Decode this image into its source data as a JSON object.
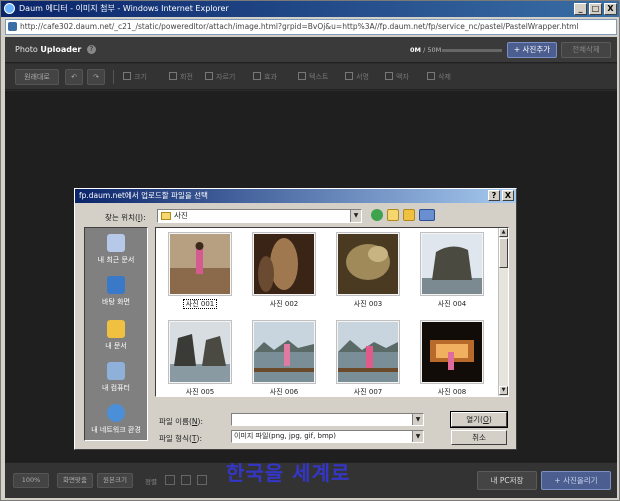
{
  "browser": {
    "title": "Daum 에디터 - 이미지 첨부 - Windows Internet Explorer",
    "address": "http://cafe302.daum.net/_c21_/static/poweredltor/attach/image.html?grpid=BvOj&u=http%3A//fp.daum.net/fp/service_nc/pastel/PastelWrapper.html",
    "controls": {
      "minimize": "_",
      "maximize": "□",
      "close": "X"
    }
  },
  "uploader": {
    "title_prefix": "Photo",
    "title_bold": "Uploader",
    "help": "?",
    "usage_current": "0M",
    "usage_total": "/ 50M",
    "usage_fraction": 0.0,
    "add_photo": "+ 사진추가",
    "delete_all": "전체삭제",
    "toolbar": {
      "original": "원래대로",
      "undo": "↶",
      "redo": "↷",
      "tools": [
        "크기",
        "회전",
        "자르기",
        "효과",
        "텍스트",
        "서명",
        "액자",
        "삭제"
      ]
    },
    "bottom": {
      "zoom": "100%",
      "fit_screen": "화면맞춤",
      "original_size": "원본크기",
      "sort_label": "정렬",
      "my_pc_save": "내 PC저장",
      "upload": "+ 사진올리기"
    },
    "watermark": "한국을 세계로"
  },
  "dialog": {
    "title": "fp.daum.net에서 업로드할 파일을 선택",
    "help": "?",
    "close": "X",
    "look_in_label": "찾는 위치(",
    "look_in_key": "I",
    "look_in_suffix": "):",
    "look_in_value": "사진",
    "places": [
      "내 최근 문서",
      "바탕 화면",
      "내 문서",
      "내 컴퓨터",
      "내 네트워크 환경"
    ],
    "files": [
      {
        "name": "사진 001",
        "selected": true
      },
      {
        "name": "사진 002",
        "selected": false
      },
      {
        "name": "사진 003",
        "selected": false
      },
      {
        "name": "사진 004",
        "selected": false
      },
      {
        "name": "사진 005",
        "selected": false
      },
      {
        "name": "사진 006",
        "selected": false
      },
      {
        "name": "사진 007",
        "selected": false
      },
      {
        "name": "사진 008",
        "selected": false
      }
    ],
    "filename_label": "파일 이름(",
    "filename_key": "N",
    "filename_suffix": "):",
    "filename_value": "",
    "filetype_label": "파일 형식(",
    "filetype_key": "T",
    "filetype_suffix": "):",
    "filetype_value": "이미지 파일(png, jpg, gif, bmp)",
    "open_label": "열기(",
    "open_key": "O",
    "open_suffix": ")",
    "cancel": "취소"
  }
}
